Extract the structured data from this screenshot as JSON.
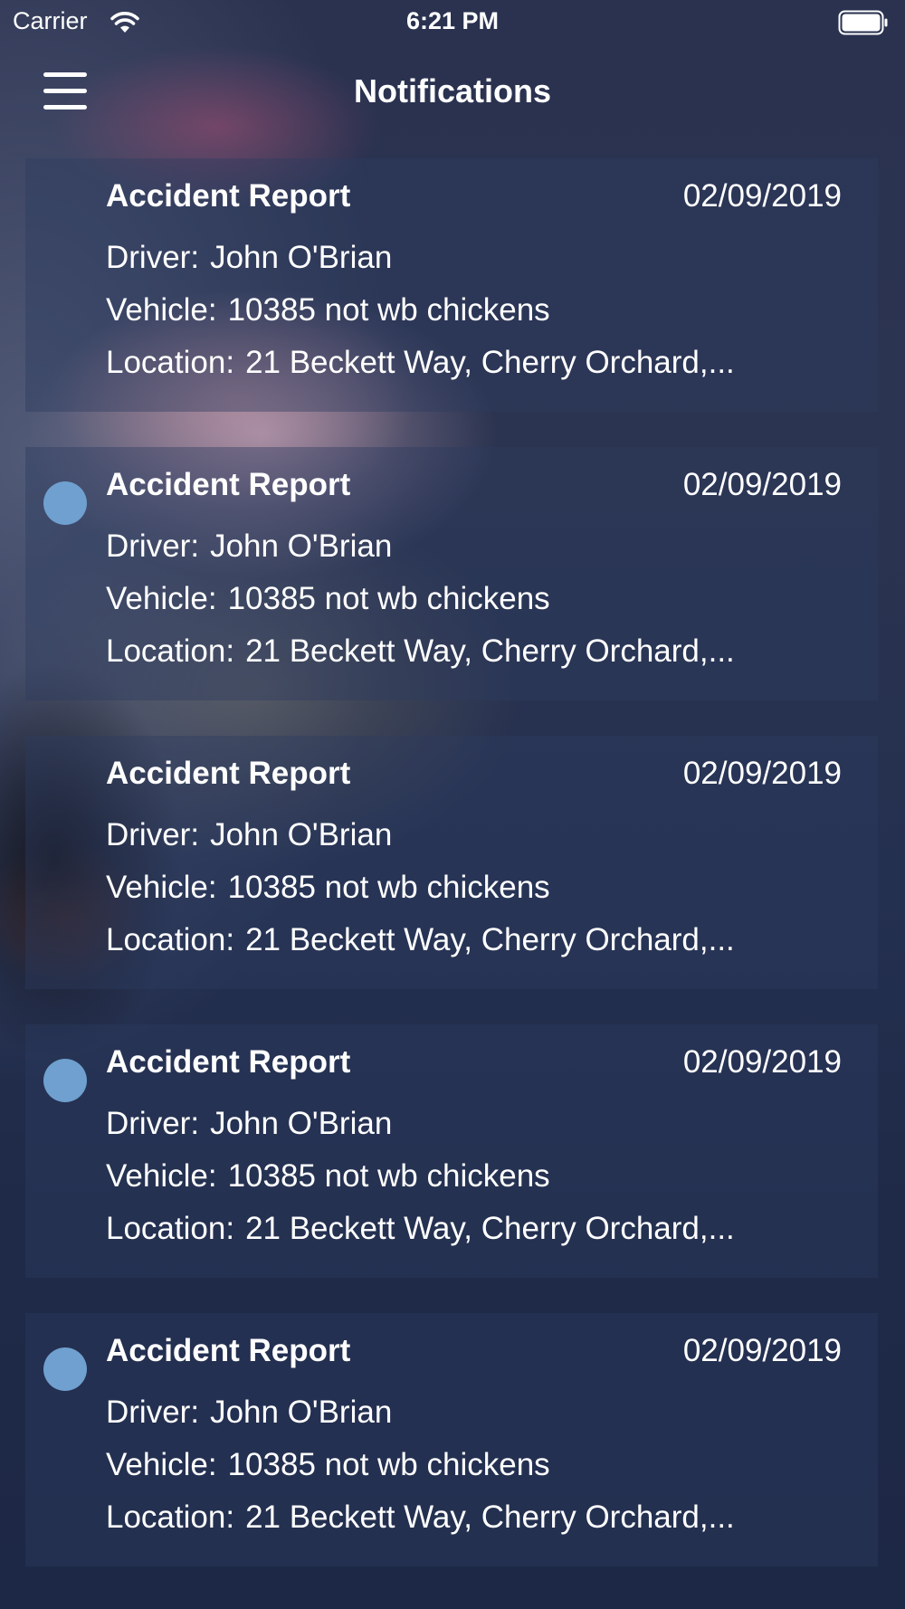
{
  "status_bar": {
    "carrier": "Carrier",
    "time": "6:21 PM",
    "wifi_icon": "wifi-icon",
    "battery_icon": "battery-icon"
  },
  "nav": {
    "title": "Notifications",
    "menu_icon": "hamburger-menu-icon"
  },
  "colors": {
    "unread_dot": "#6fa0cf",
    "card_background": "rgba(45,60,95,0.42)"
  },
  "notifications": [
    {
      "title": "Accident Report",
      "date": "02/09/2019",
      "driver_label": "Driver:",
      "driver": "John O'Brian",
      "vehicle_label": "Vehicle:",
      "vehicle": "10385 not wb chickens",
      "location_label": "Location:",
      "location": "21 Beckett Way, Cherry Orchard,...",
      "unread": false
    },
    {
      "title": "Accident Report",
      "date": "02/09/2019",
      "driver_label": "Driver:",
      "driver": "John O'Brian",
      "vehicle_label": "Vehicle:",
      "vehicle": "10385 not wb chickens",
      "location_label": "Location:",
      "location": "21 Beckett Way, Cherry Orchard,...",
      "unread": true
    },
    {
      "title": "Accident Report",
      "date": "02/09/2019",
      "driver_label": "Driver:",
      "driver": "John O'Brian",
      "vehicle_label": "Vehicle:",
      "vehicle": "10385 not wb chickens",
      "location_label": "Location:",
      "location": "21 Beckett Way, Cherry Orchard,...",
      "unread": false
    },
    {
      "title": "Accident Report",
      "date": "02/09/2019",
      "driver_label": "Driver:",
      "driver": "John O'Brian",
      "vehicle_label": "Vehicle:",
      "vehicle": "10385 not wb chickens",
      "location_label": "Location:",
      "location": "21 Beckett Way, Cherry Orchard,...",
      "unread": true
    },
    {
      "title": "Accident Report",
      "date": "02/09/2019",
      "driver_label": "Driver:",
      "driver": "John O'Brian",
      "vehicle_label": "Vehicle:",
      "vehicle": "10385 not wb chickens",
      "location_label": "Location:",
      "location": "21 Beckett Way, Cherry Orchard,...",
      "unread": true
    }
  ]
}
